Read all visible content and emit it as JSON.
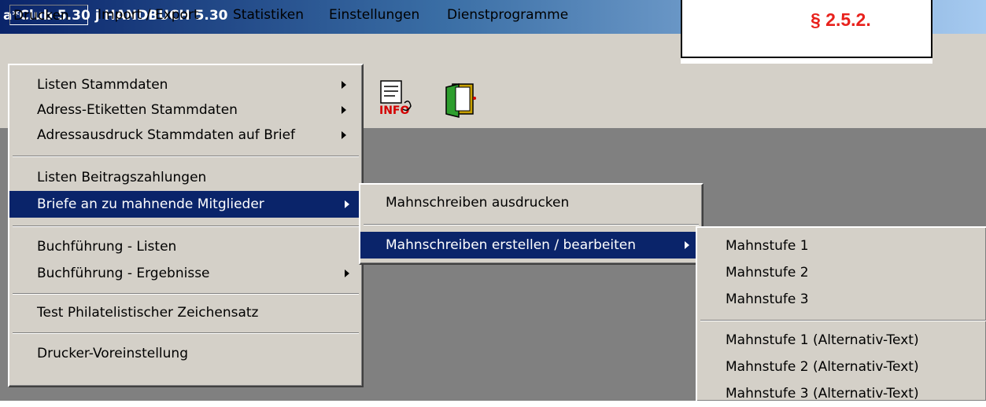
{
  "window": {
    "title": "a*Club 5.30 j HANDBUCH 5.30"
  },
  "annotation": {
    "section": "§ 2.5.2.",
    "color": "#e8211c"
  },
  "menubar": {
    "items": [
      "Drucken",
      "Import / Export",
      "Statistiken",
      "Einstellungen",
      "Dienstprogramme"
    ]
  },
  "toolbar": {
    "icons": [
      "info-icon",
      "exit-door-icon"
    ]
  },
  "drucken_menu": {
    "items": [
      {
        "label": "Listen Stammdaten",
        "submenu": true
      },
      {
        "label": "Adress-Etiketten Stammdaten",
        "submenu": true
      },
      {
        "label": "Adressausdruck Stammdaten auf Brief",
        "submenu": true
      },
      {
        "label": "Listen Beitragszahlungen",
        "submenu": false
      },
      {
        "label": "Briefe an zu mahnende Mitglieder",
        "submenu": true,
        "highlighted": true
      },
      {
        "label": "Buchführung - Listen",
        "submenu": false
      },
      {
        "label": "Buchführung - Ergebnisse",
        "submenu": true
      },
      {
        "label": "Test Philatelistischer Zeichensatz",
        "submenu": false
      },
      {
        "label": "Drucker-Voreinstellung",
        "submenu": false
      }
    ]
  },
  "briefe_menu": {
    "items": [
      {
        "label": "Mahnschreiben ausdrucken",
        "submenu": false
      },
      {
        "label": "Mahnschreiben erstellen / bearbeiten",
        "submenu": true,
        "highlighted": true
      }
    ]
  },
  "mahnschreiben_menu": {
    "items": [
      {
        "label": "Mahnstufe 1"
      },
      {
        "label": "Mahnstufe 2"
      },
      {
        "label": "Mahnstufe 3"
      },
      {
        "label": "Mahnstufe 1 (Alternativ-Text)"
      },
      {
        "label": "Mahnstufe 2 (Alternativ-Text)"
      },
      {
        "label": "Mahnstufe 3 (Alternativ-Text)"
      }
    ]
  },
  "colors": {
    "highlight": "#0a246a",
    "menu_bg": "#d4d0c8",
    "workspace": "#808080"
  }
}
